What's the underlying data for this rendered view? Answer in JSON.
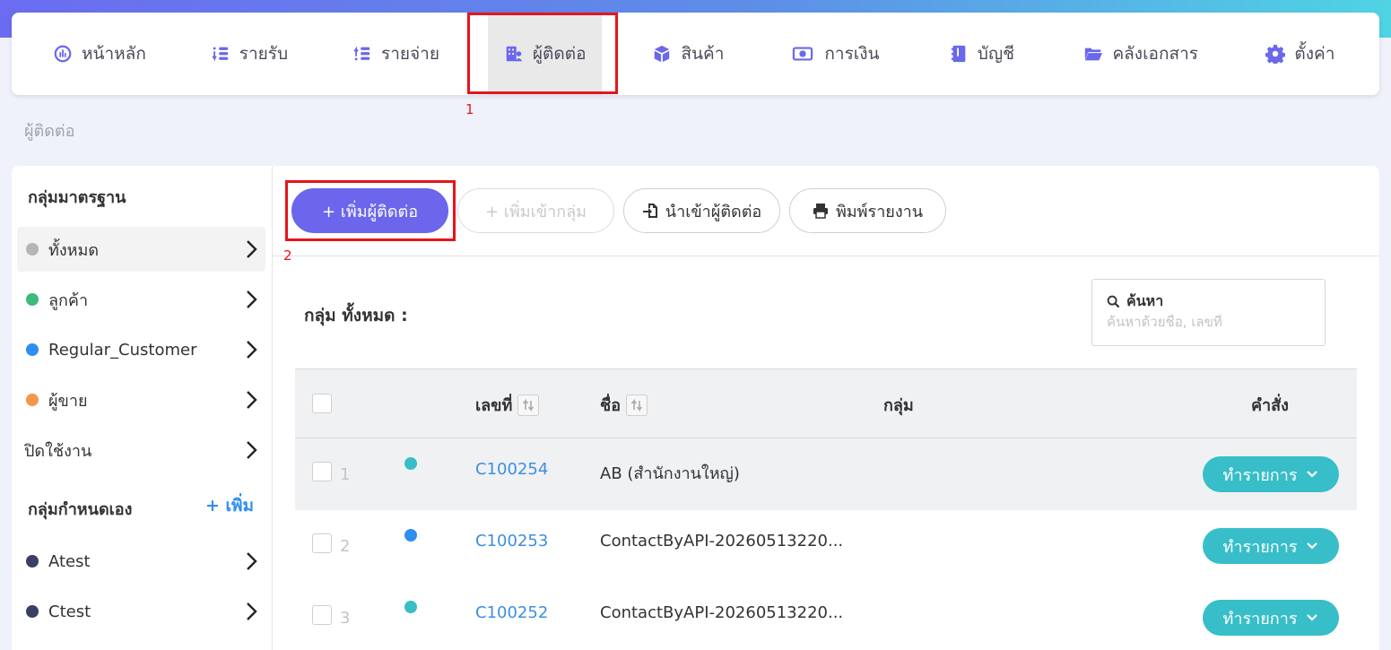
{
  "nav": {
    "items": [
      {
        "label": "หน้าหลัก",
        "icon": "dashboard-icon"
      },
      {
        "label": "รายรับ",
        "icon": "income-icon"
      },
      {
        "label": "รายจ่าย",
        "icon": "expense-icon"
      },
      {
        "label": "ผู้ติดต่อ",
        "icon": "contacts-icon"
      },
      {
        "label": "สินค้า",
        "icon": "box-icon"
      },
      {
        "label": "การเงิน",
        "icon": "money-icon"
      },
      {
        "label": "บัญชี",
        "icon": "ledger-icon"
      },
      {
        "label": "คลังเอกสาร",
        "icon": "folder-icon"
      },
      {
        "label": "ตั้งค่า",
        "icon": "gear-icon"
      }
    ],
    "active_index": 3
  },
  "annotations": {
    "nav_marker": "1",
    "add_button_marker": "2"
  },
  "breadcrumb": "ผู้ติดต่อ",
  "sidebar": {
    "standard_heading": "กลุ่มมาตรฐาน",
    "standard_items": [
      {
        "label": "ทั้งหมด",
        "color": "#b5b5b5"
      },
      {
        "label": "ลูกค้า",
        "color": "#3dba7e"
      },
      {
        "label": "Regular_Customer",
        "color": "#2f8ef0"
      },
      {
        "label": "ผู้ขาย",
        "color": "#f4974b"
      },
      {
        "label": "ปิดใช้งาน",
        "color": ""
      }
    ],
    "custom_heading": "กลุ่มกำหนดเอง",
    "custom_add_label": "+ เพิ่ม",
    "custom_items": [
      {
        "label": "Atest",
        "color": "#3c3f63"
      },
      {
        "label": "Ctest",
        "color": "#3c3f63"
      }
    ]
  },
  "toolbar": {
    "add_contact": "+ เพิ่มผู้ติดต่อ",
    "add_to_group": "+ เพิ่มเข้ากลุ่ม",
    "import_contacts": "นำเข้าผู้ติดต่อ",
    "print_report": "พิมพ์รายงาน"
  },
  "group_title": "กลุ่ม ทั้งหมด :",
  "search": {
    "label": "ค้นหา",
    "placeholder": "ค้นหาด้วยชื่อ, เลขที่"
  },
  "table": {
    "headers": {
      "code": "เลขที่",
      "name": "ชื่อ",
      "group": "กลุ่ม",
      "action": "คำสั่ง"
    },
    "rows": [
      {
        "num": "1",
        "dot": "#38bec8",
        "code": "C100254",
        "name": "AB (สำนักงานใหญ่)",
        "action": "ทำรายการ"
      },
      {
        "num": "2",
        "dot": "#2f8ef0",
        "code": "C100253",
        "name": "ContactByAPI-20260513220...",
        "action": "ทำรายการ"
      },
      {
        "num": "3",
        "dot": "#38bec8",
        "code": "C100252",
        "name": "ContactByAPI-20260513220...",
        "action": "ทำรายการ"
      }
    ]
  },
  "colors": {
    "accent": "#6c66ec",
    "action": "#38bec8",
    "highlight": "#e8141b"
  }
}
